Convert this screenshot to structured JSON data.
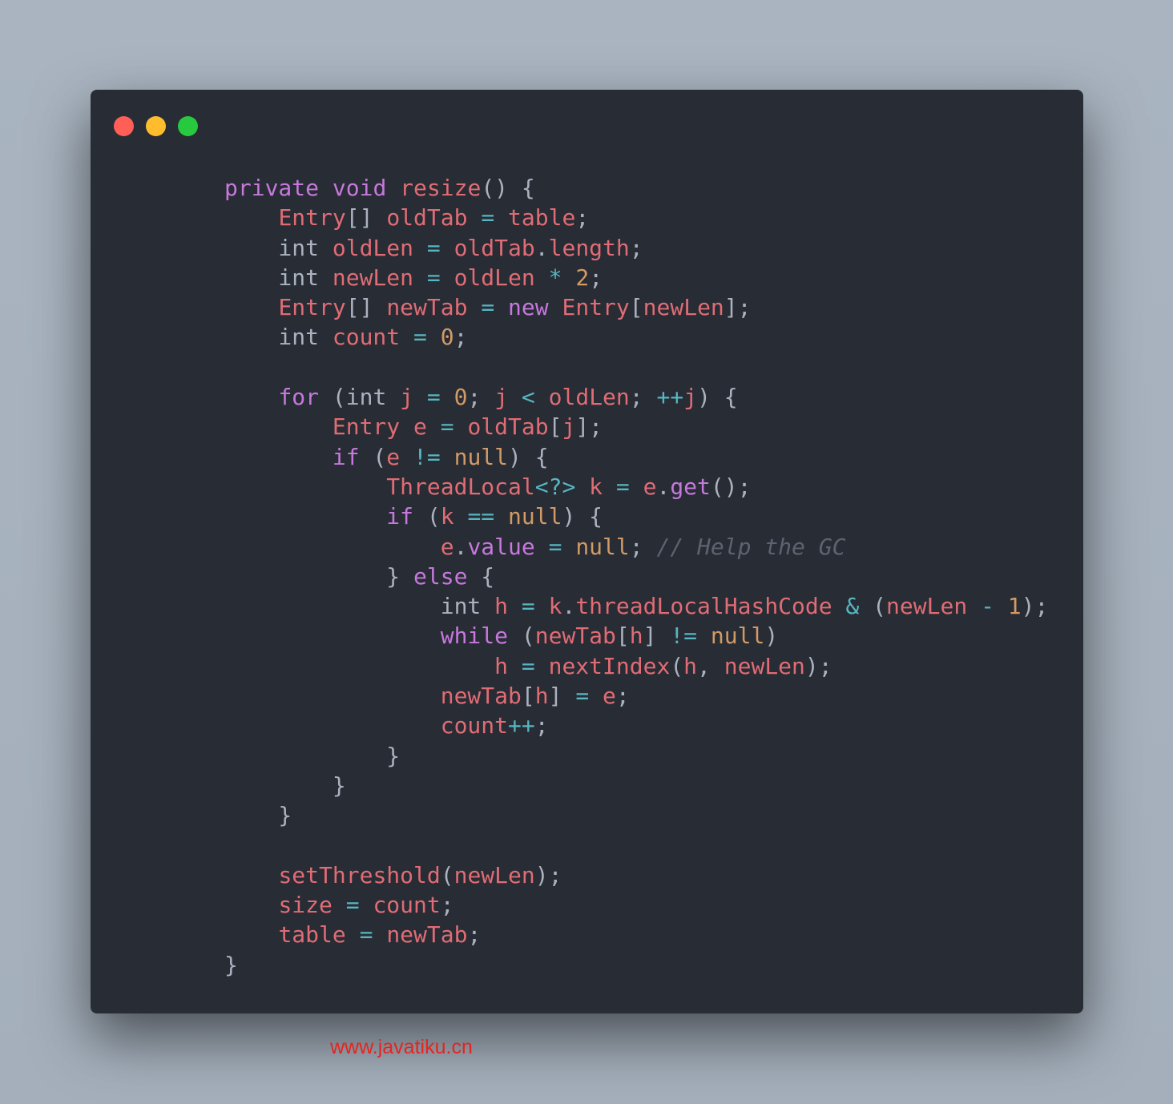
{
  "window_controls": [
    "close",
    "minimize",
    "maximize"
  ],
  "colors": {
    "keyword": "#c678dd",
    "identifier": "#e06c75",
    "plain": "#abb2bf",
    "operator": "#56b6c2",
    "literal": "#d19a66",
    "comment": "#5c6370",
    "background": "#282c34"
  },
  "code_lines": [
    [
      [
        "k",
        "private"
      ],
      [
        "p",
        " "
      ],
      [
        "k",
        "void"
      ],
      [
        "p",
        " "
      ],
      [
        "v",
        "resize"
      ],
      [
        "p",
        "() {"
      ]
    ],
    [
      [
        "p",
        "    "
      ],
      [
        "v",
        "Entry"
      ],
      [
        "p",
        "[] "
      ],
      [
        "v",
        "oldTab"
      ],
      [
        "p",
        " "
      ],
      [
        "o",
        "="
      ],
      [
        "p",
        " "
      ],
      [
        "v",
        "table"
      ],
      [
        "p",
        ";"
      ]
    ],
    [
      [
        "p",
        "    int "
      ],
      [
        "v",
        "oldLen"
      ],
      [
        "p",
        " "
      ],
      [
        "o",
        "="
      ],
      [
        "p",
        " "
      ],
      [
        "v",
        "oldTab"
      ],
      [
        "p",
        "."
      ],
      [
        "v",
        "length"
      ],
      [
        "p",
        ";"
      ]
    ],
    [
      [
        "p",
        "    int "
      ],
      [
        "v",
        "newLen"
      ],
      [
        "p",
        " "
      ],
      [
        "o",
        "="
      ],
      [
        "p",
        " "
      ],
      [
        "v",
        "oldLen"
      ],
      [
        "p",
        " "
      ],
      [
        "o",
        "*"
      ],
      [
        "p",
        " "
      ],
      [
        "n",
        "2"
      ],
      [
        "p",
        ";"
      ]
    ],
    [
      [
        "p",
        "    "
      ],
      [
        "v",
        "Entry"
      ],
      [
        "p",
        "[] "
      ],
      [
        "v",
        "newTab"
      ],
      [
        "p",
        " "
      ],
      [
        "o",
        "="
      ],
      [
        "p",
        " "
      ],
      [
        "k",
        "new"
      ],
      [
        "p",
        " "
      ],
      [
        "v",
        "Entry"
      ],
      [
        "p",
        "["
      ],
      [
        "v",
        "newLen"
      ],
      [
        "p",
        "];"
      ]
    ],
    [
      [
        "p",
        "    int "
      ],
      [
        "v",
        "count"
      ],
      [
        "p",
        " "
      ],
      [
        "o",
        "="
      ],
      [
        "p",
        " "
      ],
      [
        "n",
        "0"
      ],
      [
        "p",
        ";"
      ]
    ],
    [
      [
        "p",
        ""
      ]
    ],
    [
      [
        "p",
        "    "
      ],
      [
        "k",
        "for"
      ],
      [
        "p",
        " (int "
      ],
      [
        "v",
        "j"
      ],
      [
        "p",
        " "
      ],
      [
        "o",
        "="
      ],
      [
        "p",
        " "
      ],
      [
        "n",
        "0"
      ],
      [
        "p",
        "; "
      ],
      [
        "v",
        "j"
      ],
      [
        "p",
        " "
      ],
      [
        "o",
        "<"
      ],
      [
        "p",
        " "
      ],
      [
        "v",
        "oldLen"
      ],
      [
        "p",
        "; "
      ],
      [
        "o",
        "++"
      ],
      [
        "v",
        "j"
      ],
      [
        "p",
        ") {"
      ]
    ],
    [
      [
        "p",
        "        "
      ],
      [
        "v",
        "Entry"
      ],
      [
        "p",
        " "
      ],
      [
        "v",
        "e"
      ],
      [
        "p",
        " "
      ],
      [
        "o",
        "="
      ],
      [
        "p",
        " "
      ],
      [
        "v",
        "oldTab"
      ],
      [
        "p",
        "["
      ],
      [
        "v",
        "j"
      ],
      [
        "p",
        "];"
      ]
    ],
    [
      [
        "p",
        "        "
      ],
      [
        "k",
        "if"
      ],
      [
        "p",
        " ("
      ],
      [
        "v",
        "e"
      ],
      [
        "p",
        " "
      ],
      [
        "o",
        "!="
      ],
      [
        "p",
        " "
      ],
      [
        "n",
        "null"
      ],
      [
        "p",
        ") {"
      ]
    ],
    [
      [
        "p",
        "            "
      ],
      [
        "v",
        "ThreadLocal"
      ],
      [
        "o",
        "<?>"
      ],
      [
        "p",
        " "
      ],
      [
        "v",
        "k"
      ],
      [
        "p",
        " "
      ],
      [
        "o",
        "="
      ],
      [
        "p",
        " "
      ],
      [
        "v",
        "e"
      ],
      [
        "p",
        "."
      ],
      [
        "k",
        "get"
      ],
      [
        "p",
        "();"
      ]
    ],
    [
      [
        "p",
        "            "
      ],
      [
        "k",
        "if"
      ],
      [
        "p",
        " ("
      ],
      [
        "v",
        "k"
      ],
      [
        "p",
        " "
      ],
      [
        "o",
        "=="
      ],
      [
        "p",
        " "
      ],
      [
        "n",
        "null"
      ],
      [
        "p",
        ") {"
      ]
    ],
    [
      [
        "p",
        "                "
      ],
      [
        "v",
        "e"
      ],
      [
        "p",
        "."
      ],
      [
        "k",
        "value"
      ],
      [
        "p",
        " "
      ],
      [
        "o",
        "="
      ],
      [
        "p",
        " "
      ],
      [
        "n",
        "null"
      ],
      [
        "p",
        "; "
      ],
      [
        "c",
        "// Help the GC"
      ]
    ],
    [
      [
        "p",
        "            } "
      ],
      [
        "k",
        "else"
      ],
      [
        "p",
        " {"
      ]
    ],
    [
      [
        "p",
        "                int "
      ],
      [
        "v",
        "h"
      ],
      [
        "p",
        " "
      ],
      [
        "o",
        "="
      ],
      [
        "p",
        " "
      ],
      [
        "v",
        "k"
      ],
      [
        "p",
        "."
      ],
      [
        "v",
        "threadLocalHashCode"
      ],
      [
        "p",
        " "
      ],
      [
        "o",
        "&"
      ],
      [
        "p",
        " ("
      ],
      [
        "v",
        "newLen"
      ],
      [
        "p",
        " "
      ],
      [
        "o",
        "-"
      ],
      [
        "p",
        " "
      ],
      [
        "n",
        "1"
      ],
      [
        "p",
        ");"
      ]
    ],
    [
      [
        "p",
        "                "
      ],
      [
        "k",
        "while"
      ],
      [
        "p",
        " ("
      ],
      [
        "v",
        "newTab"
      ],
      [
        "p",
        "["
      ],
      [
        "v",
        "h"
      ],
      [
        "p",
        "] "
      ],
      [
        "o",
        "!="
      ],
      [
        "p",
        " "
      ],
      [
        "n",
        "null"
      ],
      [
        "p",
        ")"
      ]
    ],
    [
      [
        "p",
        "                    "
      ],
      [
        "v",
        "h"
      ],
      [
        "p",
        " "
      ],
      [
        "o",
        "="
      ],
      [
        "p",
        " "
      ],
      [
        "v",
        "nextIndex"
      ],
      [
        "p",
        "("
      ],
      [
        "v",
        "h"
      ],
      [
        "p",
        ", "
      ],
      [
        "v",
        "newLen"
      ],
      [
        "p",
        ");"
      ]
    ],
    [
      [
        "p",
        "                "
      ],
      [
        "v",
        "newTab"
      ],
      [
        "p",
        "["
      ],
      [
        "v",
        "h"
      ],
      [
        "p",
        "] "
      ],
      [
        "o",
        "="
      ],
      [
        "p",
        " "
      ],
      [
        "v",
        "e"
      ],
      [
        "p",
        ";"
      ]
    ],
    [
      [
        "p",
        "                "
      ],
      [
        "v",
        "count"
      ],
      [
        "o",
        "++"
      ],
      [
        "p",
        ";"
      ]
    ],
    [
      [
        "p",
        "            }"
      ]
    ],
    [
      [
        "p",
        "        }"
      ]
    ],
    [
      [
        "p",
        "    }"
      ]
    ],
    [
      [
        "p",
        ""
      ]
    ],
    [
      [
        "p",
        "    "
      ],
      [
        "v",
        "setThreshold"
      ],
      [
        "p",
        "("
      ],
      [
        "v",
        "newLen"
      ],
      [
        "p",
        ");"
      ]
    ],
    [
      [
        "p",
        "    "
      ],
      [
        "v",
        "size"
      ],
      [
        "p",
        " "
      ],
      [
        "o",
        "="
      ],
      [
        "p",
        " "
      ],
      [
        "v",
        "count"
      ],
      [
        "p",
        ";"
      ]
    ],
    [
      [
        "p",
        "    "
      ],
      [
        "v",
        "table"
      ],
      [
        "p",
        " "
      ],
      [
        "o",
        "="
      ],
      [
        "p",
        " "
      ],
      [
        "v",
        "newTab"
      ],
      [
        "p",
        ";"
      ]
    ],
    [
      [
        "p",
        "}"
      ]
    ]
  ],
  "watermark": "www.javatiku.cn"
}
